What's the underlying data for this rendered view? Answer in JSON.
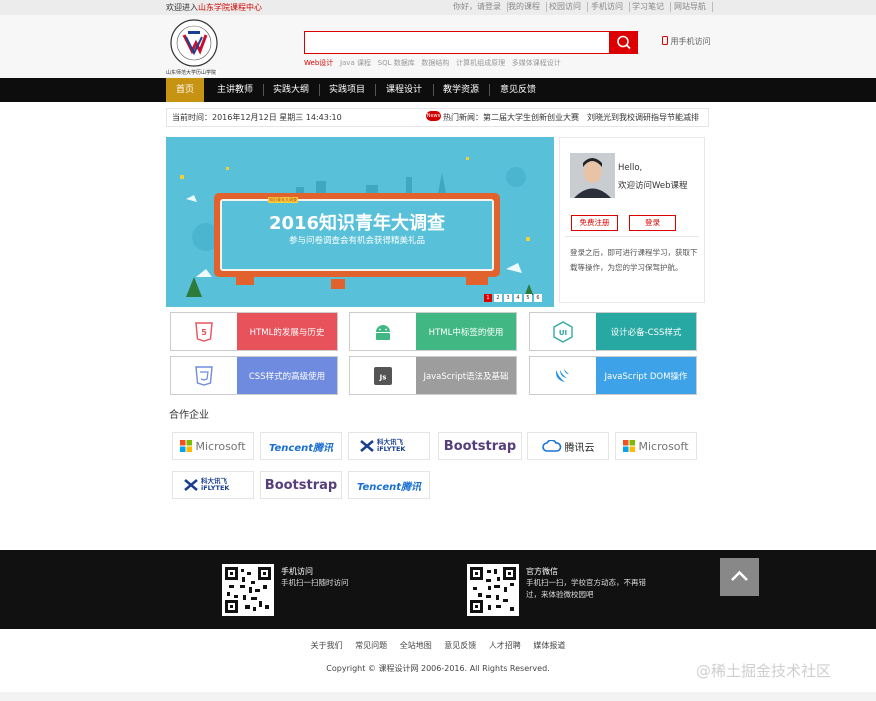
{
  "topbar": {
    "welcome_prefix": "欢迎进入",
    "welcome_site": "山东学院课程中心",
    "links": [
      "你好，请登录",
      "我的课程",
      "校园访问",
      "手机访问",
      "学习笔记",
      "网站导航"
    ]
  },
  "search": {
    "placeholder": "",
    "hot_first": "Web设计",
    "hot_words": [
      "Java 课程",
      "SQL 数据库",
      "数据结构",
      "计算机组成原理",
      "多媒体课程设计"
    ]
  },
  "mobile": {
    "label": "用手机访问"
  },
  "logo": {
    "caption": "山东师范大学历山学院"
  },
  "nav": {
    "items": [
      "首页",
      "主讲教师",
      "实践大纲",
      "实践项目",
      "课程设计",
      "教学资源",
      "意见反馈"
    ]
  },
  "info": {
    "datetime": "当前时间：2016年12月12日 星期三 14:43:10",
    "news_badge": "News",
    "news": "热门新闻：第二届大学生创新创业大赛　刘晓光到我校调研指导节能减排"
  },
  "banner": {
    "tag": "知识青年大调查",
    "title": "2016知识青年大调查",
    "subtitle": "参与问卷调查会有机会获得精美礼品",
    "pages": [
      "1",
      "2",
      "3",
      "4",
      "5",
      "6"
    ],
    "active_page": 1
  },
  "login": {
    "hello": "Hello,",
    "welcome": "欢迎访问Web课程",
    "register": "免费注册",
    "login": "登录",
    "tip": "登录之后，即可进行课程学习，获取下载等操作，为您的学习保驾护航。"
  },
  "tiles": [
    {
      "icon": "html5-icon",
      "badge": "HTML",
      "label": "HTML的发展与历史",
      "color": "#e8525b",
      "accent": "#e8525b"
    },
    {
      "icon": "android-icon",
      "badge": "",
      "label": "HTML中标签的使用",
      "color": "#41b883",
      "accent": "#41b883"
    },
    {
      "icon": "ui-icon",
      "badge": "UI",
      "label": "设计必备-CSS样式",
      "color": "#27a8a2",
      "accent": "#27a8a2"
    },
    {
      "icon": "css3-icon",
      "badge": "",
      "label": "CSS样式的高级使用",
      "color": "#6f8bdf",
      "accent": "#6f8bdf"
    },
    {
      "icon": "js-icon",
      "badge": "Js",
      "label": "JavaScript语法及基础",
      "color": "#9d9d9d",
      "accent": "#555555"
    },
    {
      "icon": "jquery-icon",
      "badge": "",
      "label": "JavaScript DOM操作",
      "color": "#3ea2e8",
      "accent": "#1d8fe0"
    }
  ],
  "partners": {
    "title": "合作企业",
    "logos": [
      {
        "name": "Microsoft",
        "kind": "microsoft"
      },
      {
        "name": "Tencent腾讯",
        "kind": "tencent"
      },
      {
        "name": "科大讯飞 iFLYTEK",
        "kind": "iflytek"
      },
      {
        "name": "Bootstrap",
        "kind": "bootstrap"
      },
      {
        "name": "腾讯云",
        "kind": "qcloud"
      },
      {
        "name": "Microsoft",
        "kind": "microsoft"
      },
      {
        "name": "科大讯飞 iFLYTEK",
        "kind": "iflytek"
      },
      {
        "name": "Bootstrap",
        "kind": "bootstrap"
      },
      {
        "name": "Tencent腾讯",
        "kind": "tencent"
      }
    ]
  },
  "footer": {
    "qr1": {
      "title": "手机访问",
      "desc": "手机扫一扫随时访问"
    },
    "qr2": {
      "title": "官方微信",
      "desc": "手机扫一扫，学校官方动态，不再错过，来体验微校园吧"
    },
    "links": [
      "关于我们",
      "常见问题",
      "全站地图",
      "意见反馈",
      "人才招聘",
      "媒体报道"
    ],
    "copyright": "Copyright © 课程设计网 2006-2016. All Rights Reserved."
  },
  "watermark": "@稀土掘金技术社区",
  "colors": {
    "brand_red": "#d10000",
    "nav_bg": "#0d0d0d",
    "nav_active": "#c79312",
    "banner_bg": "#58c1d9"
  }
}
